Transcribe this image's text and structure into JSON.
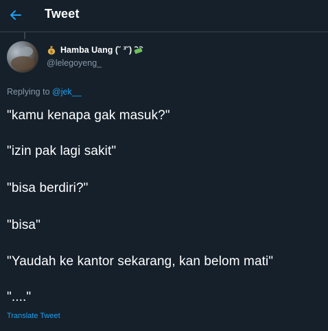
{
  "header": {
    "title": "Tweet",
    "back_icon": "arrow-left-icon"
  },
  "colors": {
    "background": "#15202b",
    "accent": "#1da1f2",
    "muted": "#8899a6",
    "divider": "#38444d",
    "text": "#ffffff"
  },
  "author": {
    "name_prefix_icon": "money-bag-icon",
    "display_name": "Hamba Uang (˘ ³˘)",
    "name_suffix_icon": "money-with-wings-icon",
    "handle": "@lelegoyeng_"
  },
  "reply": {
    "prefix": "Replying to ",
    "mention": "@jek__"
  },
  "tweet": {
    "lines": [
      "\"kamu kenapa gak masuk?\"",
      "\"izin pak lagi sakit\"",
      "\"bisa berdiri?\"",
      "\"bisa\"",
      "\"Yaudah ke kantor sekarang, kan belom mati\"",
      "\"....\""
    ]
  },
  "translate_label": "Translate Tweet"
}
